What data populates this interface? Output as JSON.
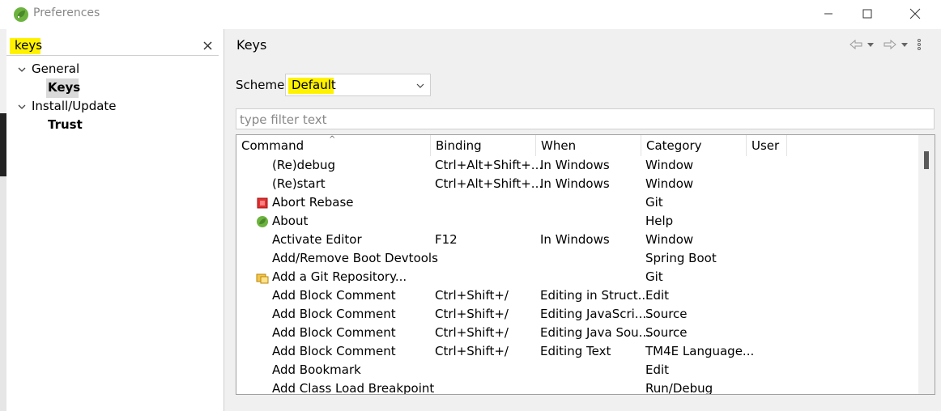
{
  "window": {
    "title": "Preferences"
  },
  "left": {
    "search_value": "keys",
    "tree": [
      {
        "label": "General"
      },
      {
        "label": "Keys"
      },
      {
        "label": "Install/Update"
      },
      {
        "label": "Trust"
      }
    ]
  },
  "page": {
    "title": "Keys",
    "scheme_label": "Scheme:",
    "scheme_value": "Default",
    "filter_placeholder": "type filter text"
  },
  "table": {
    "headers": [
      "Command",
      "Binding",
      "When",
      "Category",
      "User"
    ],
    "rows": [
      {
        "command": "(Re)debug",
        "binding": "Ctrl+Alt+Shift+...",
        "when": "In Windows",
        "category": "Window",
        "icon": ""
      },
      {
        "command": "(Re)start",
        "binding": "Ctrl+Alt+Shift+...",
        "when": "In Windows",
        "category": "Window",
        "icon": ""
      },
      {
        "command": "Abort Rebase",
        "binding": "",
        "when": "",
        "category": "Git",
        "icon": "stop-icon"
      },
      {
        "command": "About",
        "binding": "",
        "when": "",
        "category": "Help",
        "icon": "spring-leaf-icon"
      },
      {
        "command": "Activate Editor",
        "binding": "F12",
        "when": "In Windows",
        "category": "Window",
        "icon": ""
      },
      {
        "command": "Add/Remove Boot Devtools",
        "binding": "",
        "when": "",
        "category": "Spring Boot",
        "icon": ""
      },
      {
        "command": "Add a Git Repository...",
        "binding": "",
        "when": "",
        "category": "Git",
        "icon": "git-repository-icon"
      },
      {
        "command": "Add Block Comment",
        "binding": "Ctrl+Shift+/",
        "when": "Editing in Struct...",
        "category": "Edit",
        "icon": ""
      },
      {
        "command": "Add Block Comment",
        "binding": "Ctrl+Shift+/",
        "when": "Editing JavaScri...",
        "category": "Source",
        "icon": ""
      },
      {
        "command": "Add Block Comment",
        "binding": "Ctrl+Shift+/",
        "when": "Editing Java Sou...",
        "category": "Source",
        "icon": ""
      },
      {
        "command": "Add Block Comment",
        "binding": "Ctrl+Shift+/",
        "when": "Editing Text",
        "category": "TM4E Language...",
        "icon": ""
      },
      {
        "command": "Add Bookmark",
        "binding": "",
        "when": "",
        "category": "Edit",
        "icon": ""
      },
      {
        "command": "Add Class Load Breakpoint",
        "binding": "",
        "when": "",
        "category": "Run/Debug",
        "icon": ""
      }
    ]
  },
  "colors": {
    "highlight": "#fff200",
    "selection": "#d9d9d9",
    "brand_green": "#6db33f"
  }
}
